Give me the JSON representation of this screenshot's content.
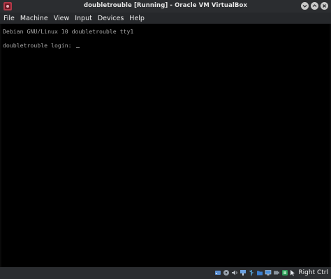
{
  "window": {
    "title": "doubletrouble [Running] - Oracle VM VirtualBox"
  },
  "menu": [
    "File",
    "Machine",
    "View",
    "Input",
    "Devices",
    "Help"
  ],
  "terminal": {
    "line1": "Debian GNU/Linux 10 doubletrouble tty1",
    "line2": "doubletrouble login: "
  },
  "statusbar": {
    "icons": [
      "hard-disk-icon",
      "optical-drive-icon",
      "audio-icon",
      "network-icon",
      "usb-icon",
      "shared-folders-icon",
      "display-icon",
      "video-capture-icon",
      "cpu-activity-icon",
      "mouse-integration-icon",
      "host-key-icon"
    ],
    "host_key_label": "Right Ctrl"
  },
  "colors": {
    "titlebar": "#2b2d30",
    "screen": "#000000",
    "terminal_text": "#a8a8a8"
  }
}
